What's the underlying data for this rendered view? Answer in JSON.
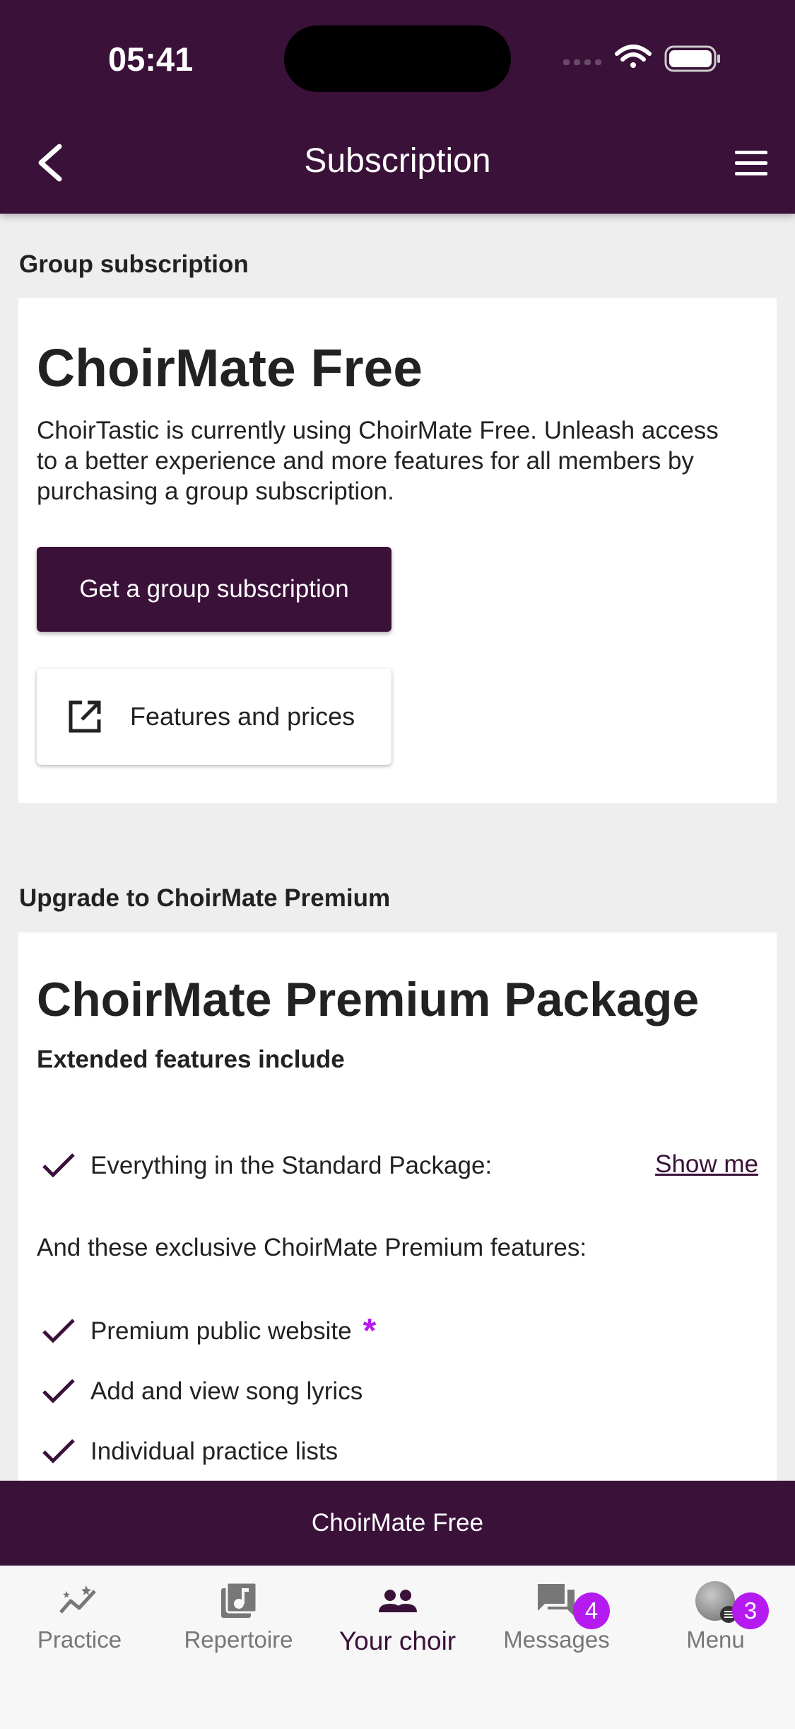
{
  "status_bar": {
    "time": "05:41"
  },
  "header": {
    "title": "Subscription"
  },
  "group_section": {
    "label": "Group subscription",
    "card": {
      "title": "ChoirMate Free",
      "description": "ChoirTastic is currently using ChoirMate Free. Unleash access to a better experience and more features for all members by purchasing a group subscription.",
      "primary_button": "Get a group subscription",
      "secondary_button": "Features and prices"
    }
  },
  "premium_section": {
    "label": "Upgrade to ChoirMate Premium",
    "card": {
      "title": "ChoirMate Premium Package",
      "subtitle": "Extended features include",
      "standard_item": "Everything in the Standard Package:",
      "show_me": "Show me",
      "exclusive_intro": "And these exclusive ChoirMate Premium features:",
      "features": [
        "Premium public website",
        "Add and view song lyrics",
        "Individual practice lists"
      ],
      "asterisk": "*"
    }
  },
  "banner": {
    "text": "ChoirMate Free"
  },
  "tabbar": {
    "tabs": [
      {
        "label": "Practice",
        "icon": "practice-chart-icon"
      },
      {
        "label": "Repertoire",
        "icon": "music-library-icon"
      },
      {
        "label": "Your choir",
        "icon": "group-people-icon"
      },
      {
        "label": "Messages",
        "icon": "chat-icon",
        "badge": "4"
      },
      {
        "label": "Menu",
        "icon": "avatar",
        "badge": "3"
      }
    ],
    "active_index": 2
  },
  "colors": {
    "brand": "#3a1139",
    "accent": "#b51bf0",
    "background": "#eeeeee",
    "card": "#ffffff"
  }
}
